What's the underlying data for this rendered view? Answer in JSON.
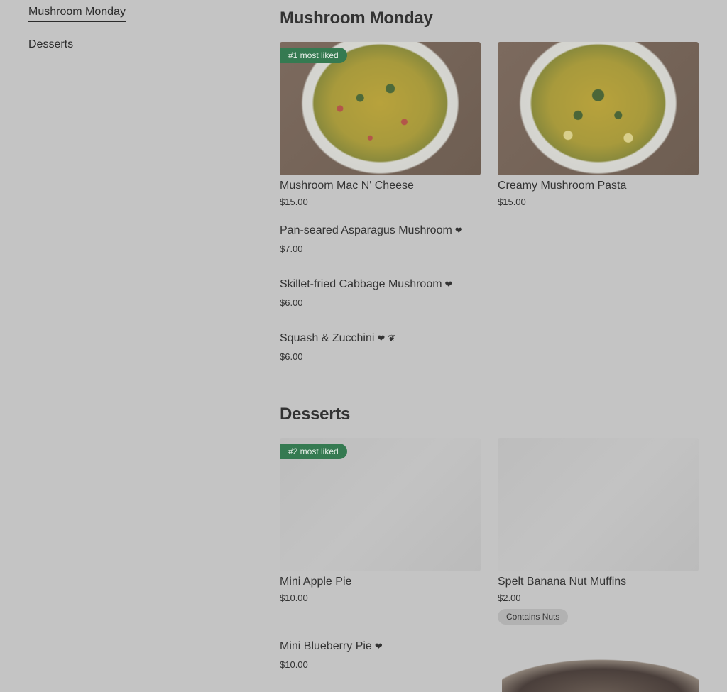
{
  "sidebar": {
    "items": [
      {
        "label": "Mushroom Monday"
      },
      {
        "label": "Desserts"
      }
    ]
  },
  "sections": {
    "mushroom": {
      "title": "Mushroom Monday",
      "cards": [
        {
          "badge": "#1 most liked",
          "name": "Mushroom Mac N' Cheese",
          "price": "$15.00",
          "image_icon": "mac-n-cheese-photo"
        },
        {
          "name": "Creamy Mushroom Pasta",
          "price": "$15.00",
          "image_icon": "pasta-photo"
        }
      ],
      "rows": [
        {
          "name": "Pan-seared Asparagus Mushroom",
          "price": "$7.00",
          "icons": [
            "heart-icon"
          ]
        },
        {
          "name": "Skillet-fried Cabbage Mushroom",
          "price": "$6.00",
          "icons": [
            "heart-icon"
          ]
        },
        {
          "name": "Squash & Zucchini",
          "price": "$6.00",
          "icons": [
            "heart-icon",
            "vegan-leaf-icon"
          ]
        }
      ]
    },
    "desserts": {
      "title": "Desserts",
      "cards": [
        {
          "badge": "#2 most liked",
          "name": "Mini Apple Pie",
          "price": "$10.00"
        },
        {
          "name": "Spelt Banana Nut Muffins",
          "price": "$2.00",
          "tag": "Contains Nuts"
        }
      ],
      "rows": [
        {
          "name": "Mini Blueberry Pie",
          "price": "$10.00",
          "icons": [
            "heart-icon"
          ]
        }
      ]
    }
  },
  "colors": {
    "overlay_bg": "#c4c4c4",
    "badge_green": "#357a51",
    "text": "#333333"
  }
}
